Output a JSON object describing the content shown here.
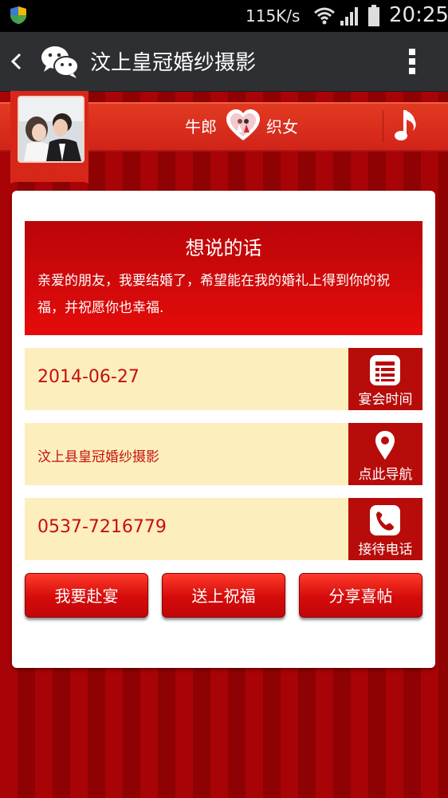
{
  "status_bar": {
    "speed": "115K/s",
    "time": "20:25",
    "icons": [
      "shield-icon",
      "wifi-icon",
      "signal-icon",
      "battery-icon"
    ]
  },
  "header": {
    "title": "汶上皇冠婚纱摄影",
    "icons": [
      "back-icon",
      "wechat-icon",
      "more-icon"
    ]
  },
  "couple": {
    "groom": "牛郎",
    "bride": "织女",
    "icons": [
      "couple-photo",
      "heart-icon",
      "music-icon"
    ]
  },
  "message": {
    "title": "想说的话",
    "body": "亲爱的朋友，我要结婚了，希望能在我的婚礼上得到你的祝福，并祝愿你也幸福."
  },
  "info": [
    {
      "value": "2014-06-27",
      "button_label": "宴会时间",
      "icon": "calendar-icon"
    },
    {
      "value": "汶上县皇冠婚纱摄影",
      "button_label": "点此导航",
      "icon": "location-pin-icon"
    },
    {
      "value": "0537-7216779",
      "button_label": "接待电话",
      "icon": "phone-icon"
    }
  ],
  "actions": [
    "我要赴宴",
    "送上祝福",
    "分享喜帖"
  ],
  "colors": {
    "primary_red": "#d40b0a",
    "info_bg": "#fdeebe",
    "info_text": "#c4110c",
    "header_bg": "#2e2f33"
  }
}
